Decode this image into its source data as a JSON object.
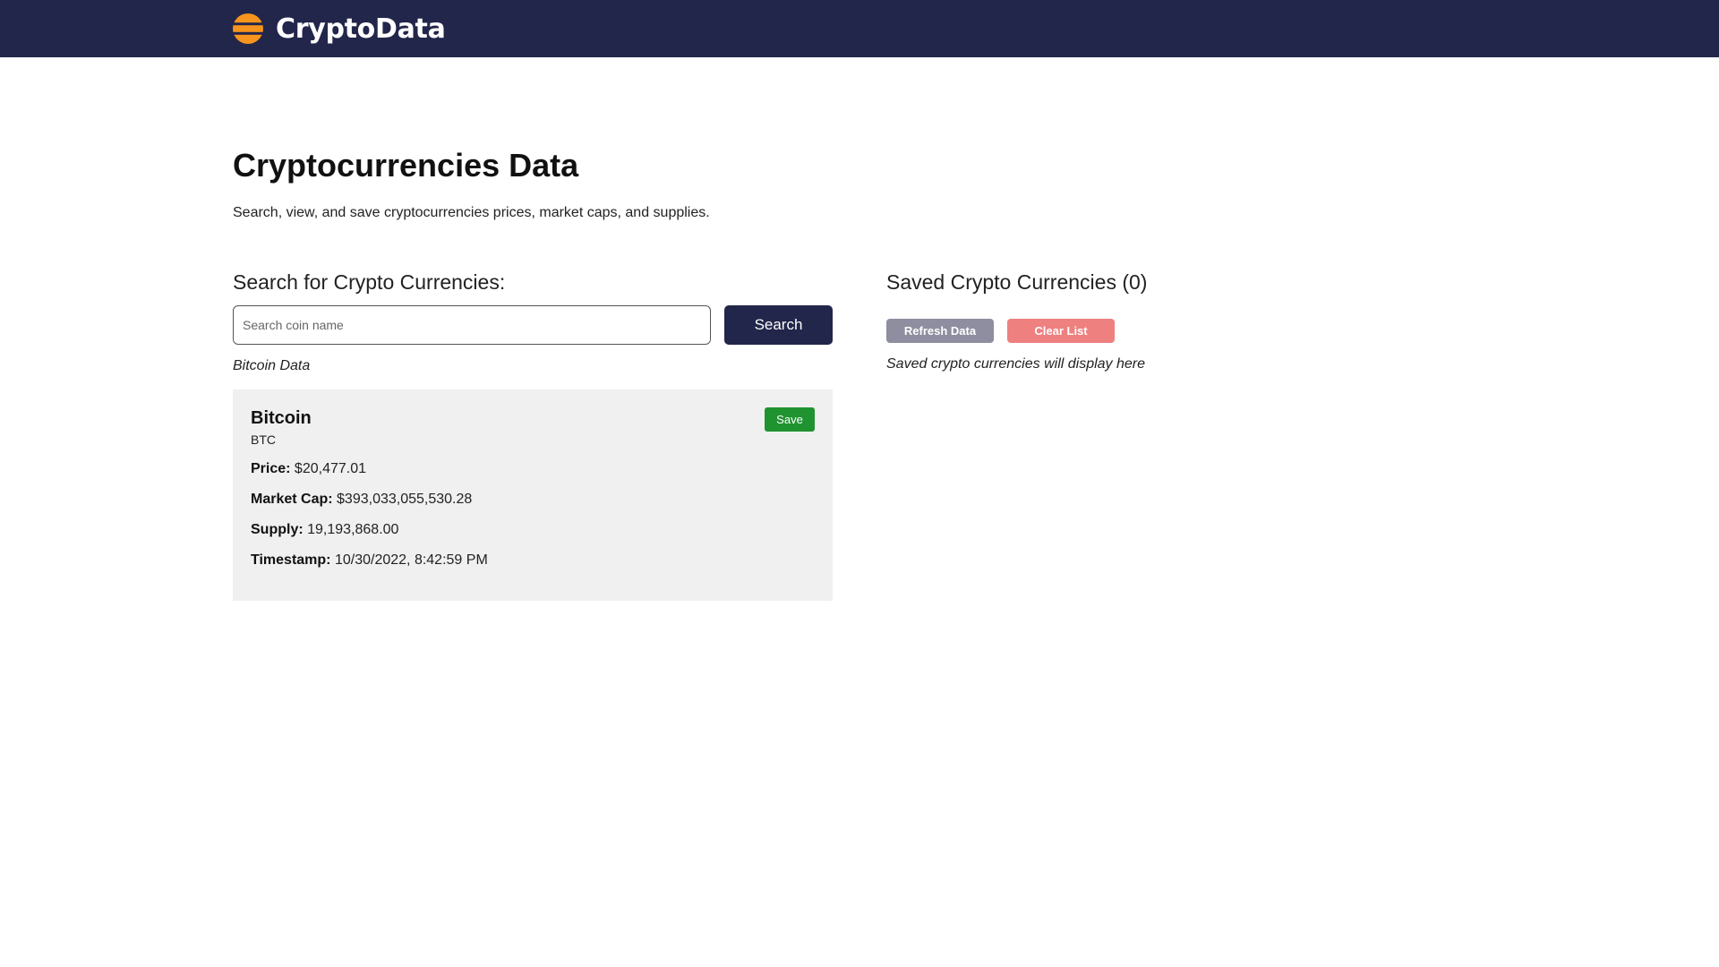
{
  "navbar": {
    "brand_name": "CryptoData",
    "logo_icon": "stacked-coins-icon",
    "logo_color": "#f7941d",
    "background": "#22264a"
  },
  "header": {
    "title": "Cryptocurrencies Data",
    "subtitle": "Search, view, and save cryptocurrencies prices, market caps, and supplies."
  },
  "search": {
    "heading": "Search for Crypto Currencies:",
    "placeholder": "Search coin name",
    "value": "",
    "button_label": "Search",
    "result_label": "Bitcoin Data"
  },
  "coin": {
    "name": "Bitcoin",
    "symbol": "BTC",
    "save_label": "Save",
    "price_label": "Price:",
    "price": "$20,477.01",
    "market_cap_label": "Market Cap:",
    "market_cap": "$393,033,055,530.28",
    "supply_label": "Supply:",
    "supply": "19,193,868.00",
    "timestamp_label": "Timestamp:",
    "timestamp": "10/30/2022, 8:42:59 PM"
  },
  "saved": {
    "heading": "Saved Crypto Currencies (0)",
    "refresh_label": "Refresh Data",
    "clear_label": "Clear List",
    "empty_message": "Saved crypto currencies will display here"
  },
  "colors": {
    "accent_dark": "#22264a",
    "save_green": "#1f9330",
    "refresh_gray": "#8e8ea0",
    "clear_red": "#ee8080",
    "card_bg": "#f0f0f0"
  }
}
